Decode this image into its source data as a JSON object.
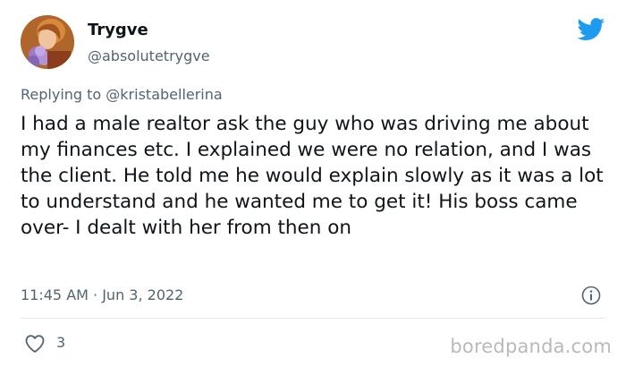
{
  "author": {
    "display_name": "Trygve",
    "handle": "@absolutetrygve",
    "avatar_icon": "avatar-photo"
  },
  "reply_context": "Replying to @kristabellerina",
  "tweet_text": "I had a male realtor ask the guy who was driving me about my finances etc. I explained we were no relation, and I was the client. He told me he would explain slowly as it was a lot to understand and he wanted me to get it! His boss came over- I dealt with her from then on",
  "timestamp": "11:45 AM · Jun 3, 2022",
  "likes": "3",
  "watermark": "boredpanda.com",
  "icons": {
    "brand": "twitter-bird-icon",
    "info": "info-icon",
    "like": "heart-icon"
  },
  "colors": {
    "brand_blue": "#1d9bf0",
    "secondary_text": "#536471",
    "primary_text": "#0f1419"
  }
}
